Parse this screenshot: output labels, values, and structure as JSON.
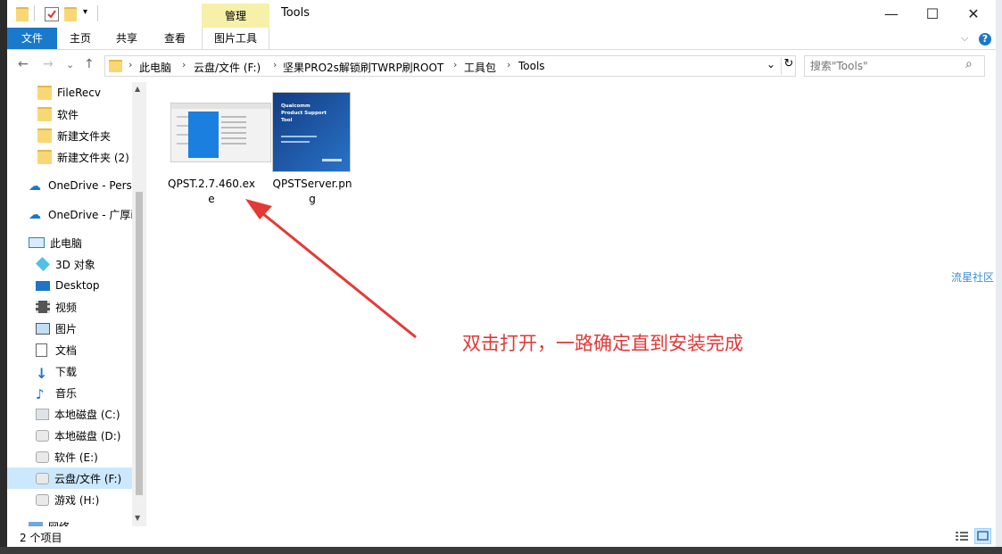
{
  "window": {
    "title": "Tools",
    "context_tab": "管理",
    "controls": {
      "minimize": "—",
      "maximize": "☐",
      "close": "✕"
    }
  },
  "ribbon": {
    "tabs": [
      "文件",
      "主页",
      "共享",
      "查看",
      "图片工具"
    ],
    "collapse_glyph": "⌵",
    "help_glyph": "?"
  },
  "address": {
    "back": "←",
    "forward": "→",
    "recent": "⌄",
    "up": "↑",
    "crumbs": [
      "此电脑",
      "云盘/文件 (F:)",
      "坚果PRO2s解锁刷TWRP刷ROOT",
      "工具包",
      "Tools"
    ],
    "separator": "›",
    "dropdown": "⌄",
    "refresh": "↻"
  },
  "search": {
    "placeholder": "搜索\"Tools\"",
    "icon": "⌕"
  },
  "nav": {
    "items": [
      {
        "label": "FileRecv",
        "icon": "folder"
      },
      {
        "label": "软件",
        "icon": "folder"
      },
      {
        "label": "新建文件夹",
        "icon": "folder"
      },
      {
        "label": "新建文件夹 (2)",
        "icon": "folder"
      },
      {
        "label": "OneDrive - Perso",
        "icon": "onedrive"
      },
      {
        "label": "OneDrive - 广厚i",
        "icon": "onedrive"
      },
      {
        "label": "此电脑",
        "icon": "pc"
      },
      {
        "label": "3D 对象",
        "icon": "cube"
      },
      {
        "label": "Desktop",
        "icon": "desktop"
      },
      {
        "label": "视频",
        "icon": "video"
      },
      {
        "label": "图片",
        "icon": "picture"
      },
      {
        "label": "文档",
        "icon": "document"
      },
      {
        "label": "下载",
        "icon": "download"
      },
      {
        "label": "音乐",
        "icon": "music"
      },
      {
        "label": "本地磁盘 (C:)",
        "icon": "windows-drive"
      },
      {
        "label": "本地磁盘 (D:)",
        "icon": "drive"
      },
      {
        "label": "软件 (E:)",
        "icon": "drive"
      },
      {
        "label": "云盘/文件 (F:)",
        "icon": "drive"
      },
      {
        "label": "游戏 (H:)",
        "icon": "drive"
      },
      {
        "label": "网络",
        "icon": "network"
      }
    ],
    "selected_index": 17,
    "scroll_up": "▲",
    "scroll_down": "▼"
  },
  "files": [
    {
      "name_line1": "QPST.2.7.460.ex",
      "name_line2": "e",
      "icon": "exe-thumbnail"
    },
    {
      "name_line1": "QPSTServer.pn",
      "name_line2": "g",
      "icon": "png-thumbnail",
      "thumb_title": "Qualcomm Product Support Tool"
    }
  ],
  "annotation": "双击打开，一路确定直到安装完成",
  "status": {
    "count": "2 个项目"
  },
  "side_overlay": "流星社区",
  "colors": {
    "file_tab": "#1979ca",
    "context_tab": "#f7f0a8",
    "annotation": "#e03838",
    "selection": "#cce8ff"
  }
}
